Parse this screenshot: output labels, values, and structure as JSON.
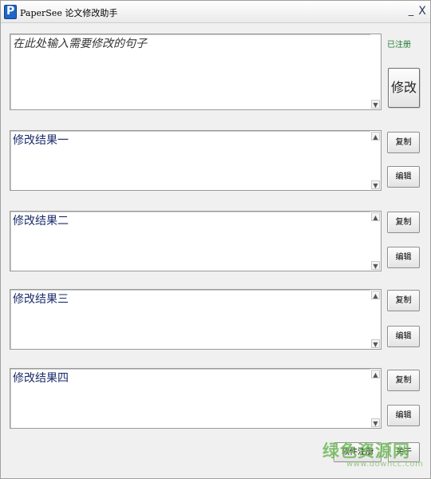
{
  "window": {
    "title": "PaperSee 论文修改助手",
    "min_label": "_",
    "close_label": "X"
  },
  "input": {
    "placeholder_text": "在此处输入需要修改的句子"
  },
  "status": {
    "registered": "已注册"
  },
  "modify_button": "修改",
  "results": [
    {
      "label": "修改结果一",
      "copy": "复制",
      "edit": "编辑"
    },
    {
      "label": "修改结果二",
      "copy": "复制",
      "edit": "编辑"
    },
    {
      "label": "修改结果三",
      "copy": "复制",
      "edit": "编辑"
    },
    {
      "label": "修改结果四",
      "copy": "复制",
      "edit": "编辑"
    }
  ],
  "footer": {
    "register_button": "软件注册",
    "about_button": "关于"
  },
  "scroll": {
    "up": "▲",
    "down": "▼"
  },
  "watermark": {
    "main": "绿色资源网",
    "sub": "www.downcc.com"
  },
  "icons": {
    "app": "papersee-app-icon",
    "app_letter": "P"
  }
}
